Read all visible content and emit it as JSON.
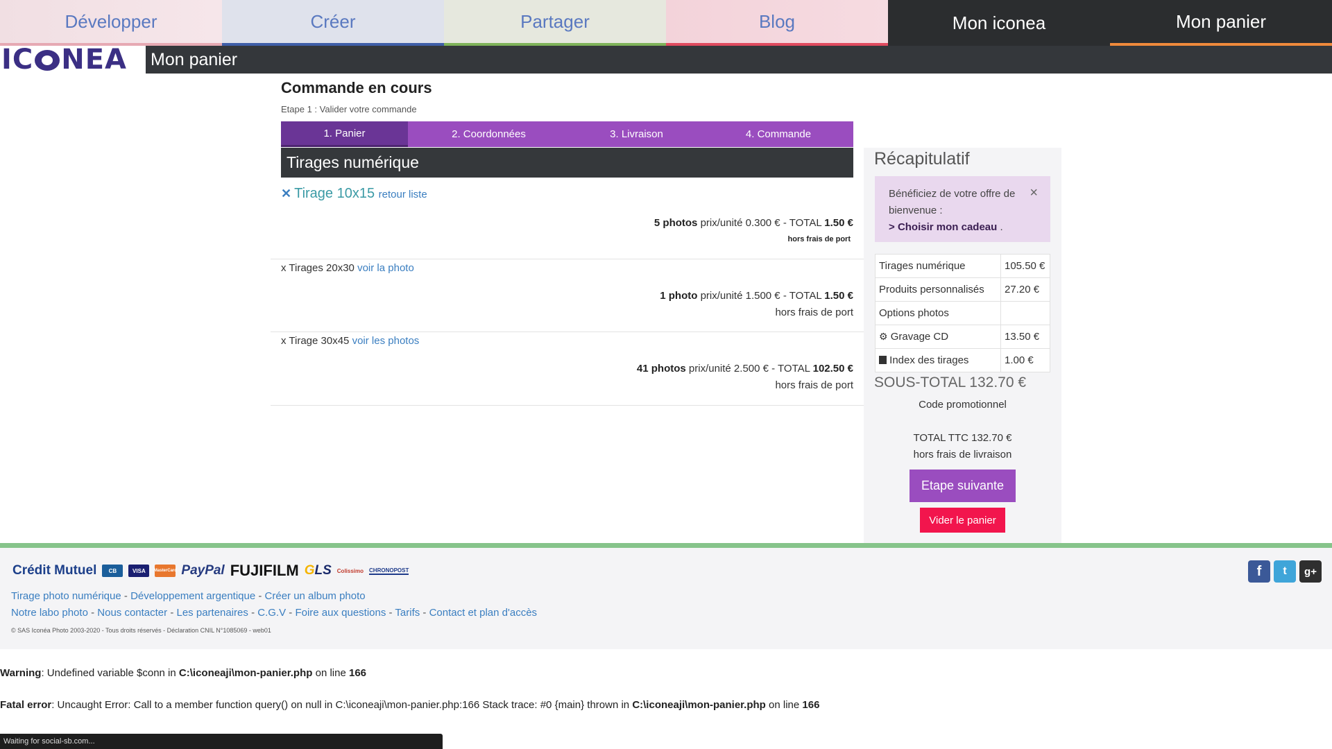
{
  "topnav": [
    {
      "label": "Développer"
    },
    {
      "label": "Créer"
    },
    {
      "label": "Partager"
    },
    {
      "label": "Blog"
    },
    {
      "label": "Mon iconea"
    },
    {
      "label": "Mon panier"
    }
  ],
  "header": {
    "logo_text": "ICONEA",
    "page_title": "Mon panier"
  },
  "order": {
    "heading": "Commande en cours",
    "step_label": "Etape 1 : Valider votre commande",
    "steps": [
      {
        "label": "1. Panier"
      },
      {
        "label": "2. Coordonnées"
      },
      {
        "label": "3. Livraison"
      },
      {
        "label": "4. Commande"
      }
    ],
    "section_title": "Tirages numérique",
    "items": [
      {
        "prefix": "✕",
        "title": "Tirage 10x15",
        "link": "retour liste",
        "qty": "5 photos",
        "unit": " prix/unité 0.300 € - TOTAL ",
        "total": "1.50 €",
        "note": "hors frais de port"
      },
      {
        "title": "x Tirages 20x30",
        "link": "voir la photo",
        "qty": "1 photo",
        "unit": " prix/unité 1.500 € - TOTAL ",
        "total": "1.50 €",
        "note": "hors frais de port"
      },
      {
        "title": "x Tirage 30x45",
        "link": "voir les photos",
        "qty": "41 photos",
        "unit": " prix/unité 2.500 € - TOTAL ",
        "total": "102.50 €",
        "note": "hors frais de port"
      }
    ]
  },
  "summary": {
    "title": "Récapitulatif",
    "offer": {
      "line1": "Bénéficiez de votre offre de bienvenue :",
      "link_prefix": "> ",
      "link": "Choisir mon cadeau",
      "suffix": " .",
      "close": "×"
    },
    "rows": [
      {
        "label": "Tirages numérique",
        "value": "105.50 €"
      },
      {
        "label": "Produits personnalisés",
        "value": "27.20 €"
      },
      {
        "label": "Options photos",
        "value": ""
      },
      {
        "icon": "gear-icon",
        "label": "Gravage CD",
        "value": "13.50 €"
      },
      {
        "icon": "calendar-icon",
        "label": "Index des tirages",
        "value": "1.00 €"
      }
    ],
    "subtotal": "SOUS-TOTAL 132.70 €",
    "promo": "Code promotionnel",
    "total": "TOTAL TTC 132.70 €",
    "total_note": "hors frais de livraison",
    "next_button": "Etape suivante",
    "clear_button": "Vider le panier"
  },
  "footer": {
    "logos": [
      "Crédit Mutuel",
      "CB",
      "VISA",
      "MasterCard",
      "PayPal",
      "FUJIFILM",
      "GLS",
      "Colissimo",
      "CHRONOPOST"
    ],
    "links_row1": [
      "Tirage photo numérique",
      "Développement argentique",
      "Créer un album photo"
    ],
    "links_row2": [
      "Notre labo photo",
      "Nous contacter",
      "Les partenaires",
      "C.G.V",
      "Foire aux questions",
      "Tarifs",
      "Contact et plan d'accès"
    ],
    "separator": " - ",
    "copyright": "© SAS Iconéa Photo 2003-2020 - Tous droits réservés - Déclaration CNIL N°1085069 - web01",
    "social": [
      "f",
      "t",
      "g+"
    ]
  },
  "errors": {
    "warning_label": "Warning",
    "warning_msg": ": Undefined variable $conn in ",
    "warning_file": "C:\\iconeaji\\mon-panier.php",
    "warning_on": " on line ",
    "warning_line": "166",
    "fatal_label": "Fatal error",
    "fatal_msg": ": Uncaught Error: Call to a member function query() on null in C:\\iconeaji\\mon-panier.php:166 Stack trace: #0 {main} thrown in ",
    "fatal_file": "C:\\iconeaji\\mon-panier.php",
    "fatal_on": " on line ",
    "fatal_line": "166"
  },
  "statusbar": "Waiting for social-sb.com...",
  "colors": {
    "accent": "#9a4dbf",
    "danger": "#f2154d",
    "dark": "#34373b",
    "link": "#3a7ec0"
  }
}
